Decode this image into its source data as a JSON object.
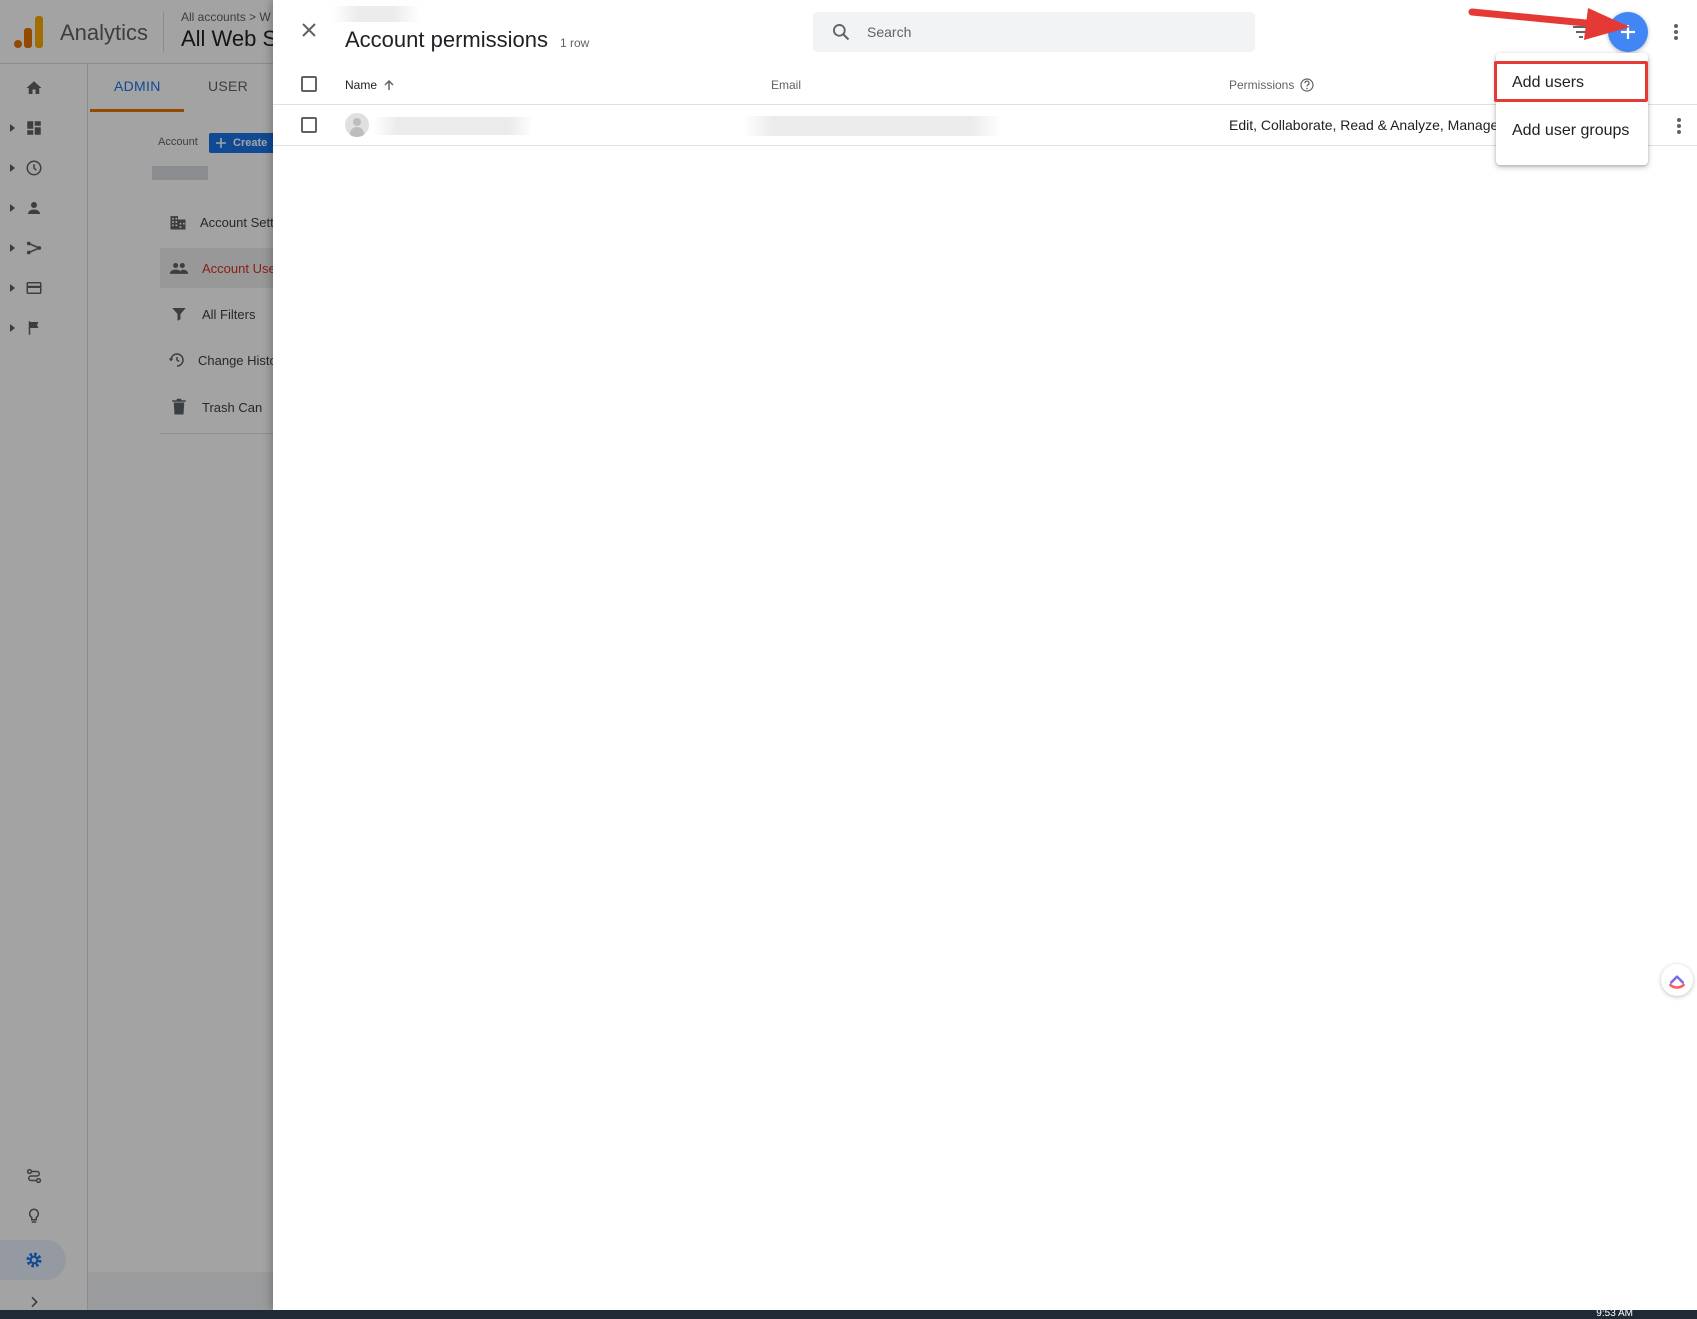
{
  "app": {
    "name": "Analytics",
    "breadcrumb": "All accounts > W",
    "property_name": "All Web S"
  },
  "tabs": [
    {
      "label": "ADMIN"
    },
    {
      "label": "USER"
    }
  ],
  "admin_column": {
    "account_label": "Account",
    "create_label": "Create",
    "menu": [
      {
        "label": "Account Settings",
        "icon": "building-icon"
      },
      {
        "label": "Account User Management",
        "icon": "people-icon"
      },
      {
        "label": "All Filters",
        "icon": "filter-icon"
      },
      {
        "label": "Change History",
        "icon": "history-icon"
      },
      {
        "label": "Trash Can",
        "icon": "trash-icon"
      }
    ]
  },
  "panel": {
    "title": "Account permissions",
    "row_count": "1 row",
    "search_placeholder": "Search",
    "columns": {
      "name": "Name",
      "email": "Email",
      "permissions": "Permissions"
    },
    "rows": [
      {
        "permissions": "Edit, Collaborate, Read & Analyze, Manage Users"
      }
    ]
  },
  "add_menu": {
    "items": [
      {
        "label": "Add users"
      },
      {
        "label": "Add user groups"
      }
    ]
  },
  "taskbar": {
    "clock": "9:53 AM"
  },
  "colors": {
    "accent_blue": "#1a73e8",
    "fab_blue": "#4285f4",
    "highlight_red": "#e53935",
    "selected_text_red": "#d93025",
    "analytics_orange": "#e37400"
  }
}
